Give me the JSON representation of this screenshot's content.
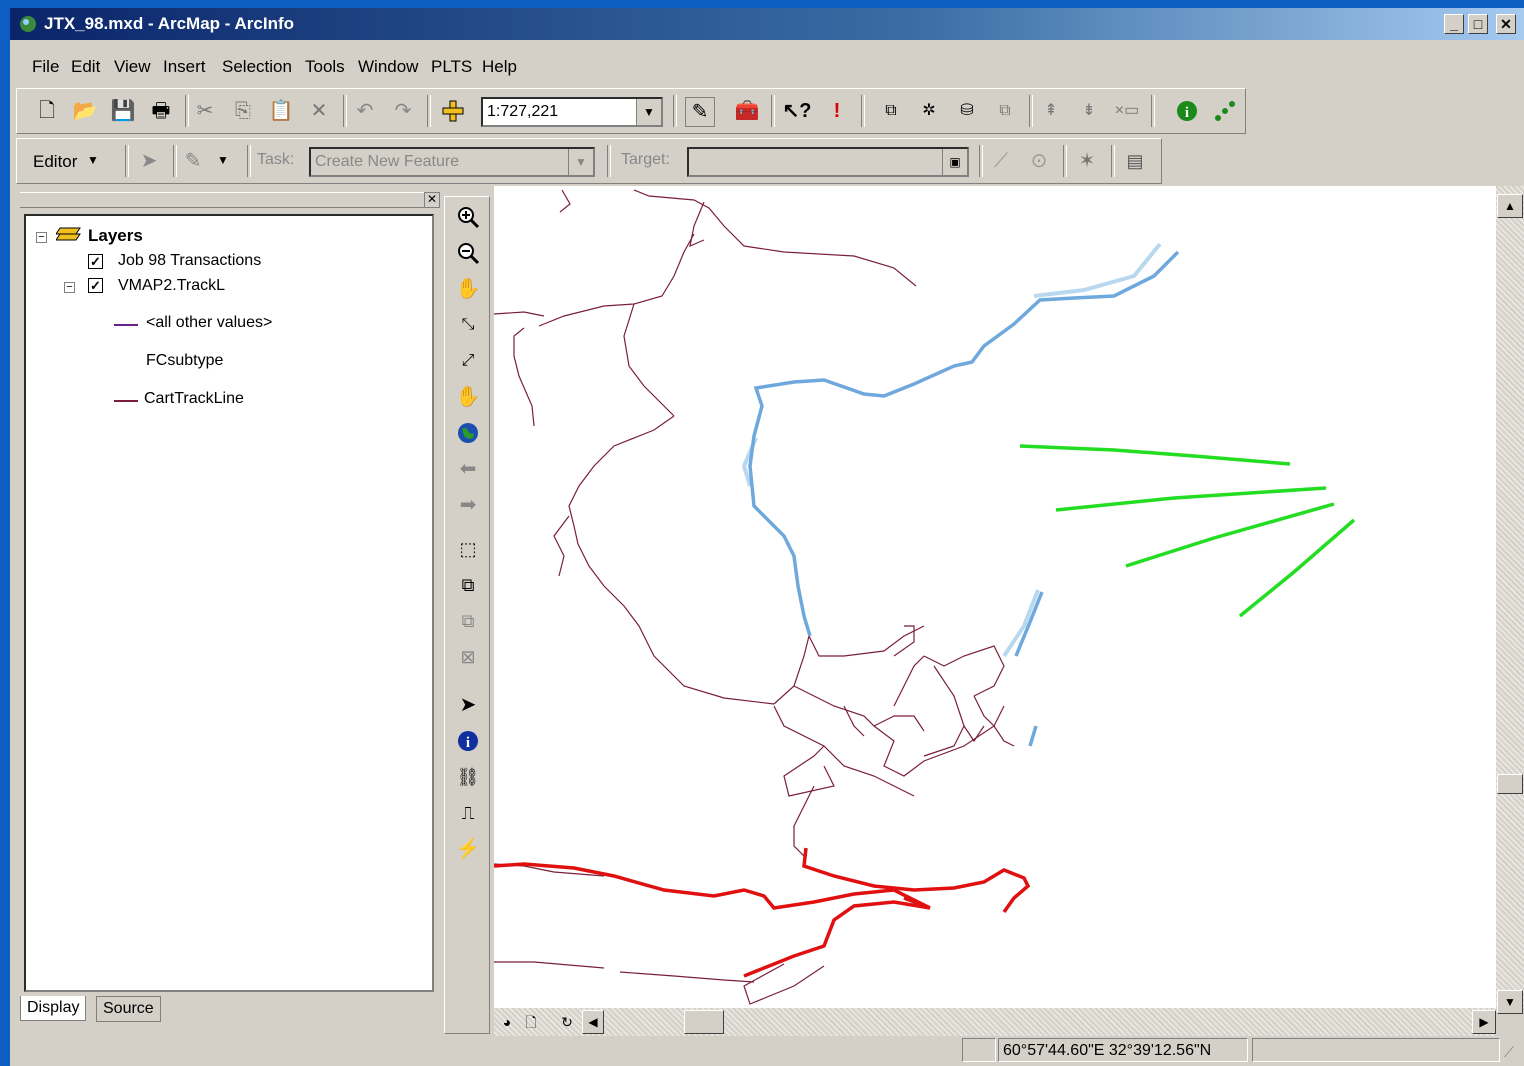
{
  "window": {
    "title": "JTX_98.mxd - ArcMap - ArcInfo",
    "min_label": "_",
    "max_label": "□",
    "close_label": "✕"
  },
  "menu": [
    "File",
    "Edit",
    "View",
    "Insert",
    "Selection",
    "Tools",
    "Window",
    "PLTS",
    "Help"
  ],
  "standard_toolbar": {
    "scale": "1:727,221",
    "icons": [
      "new-icon",
      "open-icon",
      "save-icon",
      "print-icon",
      "cut-icon",
      "copy-icon",
      "paste-icon",
      "delete-icon",
      "undo-icon",
      "redo-icon",
      "add-data-icon",
      "editor-toolbar-icon",
      "arctoolbox-icon",
      "whats-this-icon",
      "error-icon",
      "join-icon",
      "attribute-icon",
      "feature-icon",
      "copy-features-icon",
      "move-up-icon",
      "move-down-icon",
      "clear-icon",
      "identify-info-icon",
      "connect-icon"
    ]
  },
  "editor_toolbar": {
    "editor_label": "Editor",
    "task_label": "Task:",
    "task_value": "Create New Feature",
    "target_label": "Target:",
    "target_value": ""
  },
  "toc": {
    "root": "Layers",
    "layers": [
      {
        "name": "Job 98 Transactions",
        "checked": true
      },
      {
        "name": "VMAP2.TrackL",
        "checked": true,
        "legend": [
          {
            "label": "<all other values>",
            "color": "#6a1f8a"
          },
          {
            "label": "FCsubtype",
            "heading": true
          },
          {
            "label": "CartTrackLine",
            "color": "#7a1f3a"
          }
        ]
      }
    ],
    "tabs": [
      "Display",
      "Source"
    ]
  },
  "tools_column": [
    "zoom-in-icon",
    "zoom-out-icon",
    "fixed-zoom-icon",
    "zoom-extent-in-icon",
    "zoom-extent-out-icon",
    "pan-icon",
    "full-extent-icon",
    "back-icon",
    "forward-icon",
    "select-features-icon",
    "select-layer-icon",
    "clear-selection-icon",
    "zoom-selected-icon",
    "select-elements-icon",
    "identify-icon",
    "find-icon",
    "measure-icon",
    "hyperlink-icon"
  ],
  "map": {
    "track_color": "#7a1f3a",
    "blue_color": "#6fa8dc",
    "light_blue_color": "#b8d8f0",
    "green_color": "#22dd22",
    "red_color": "#e01010"
  },
  "status": {
    "coordinates": "60°57'44.60\"E  32°39'12.56\"N"
  }
}
